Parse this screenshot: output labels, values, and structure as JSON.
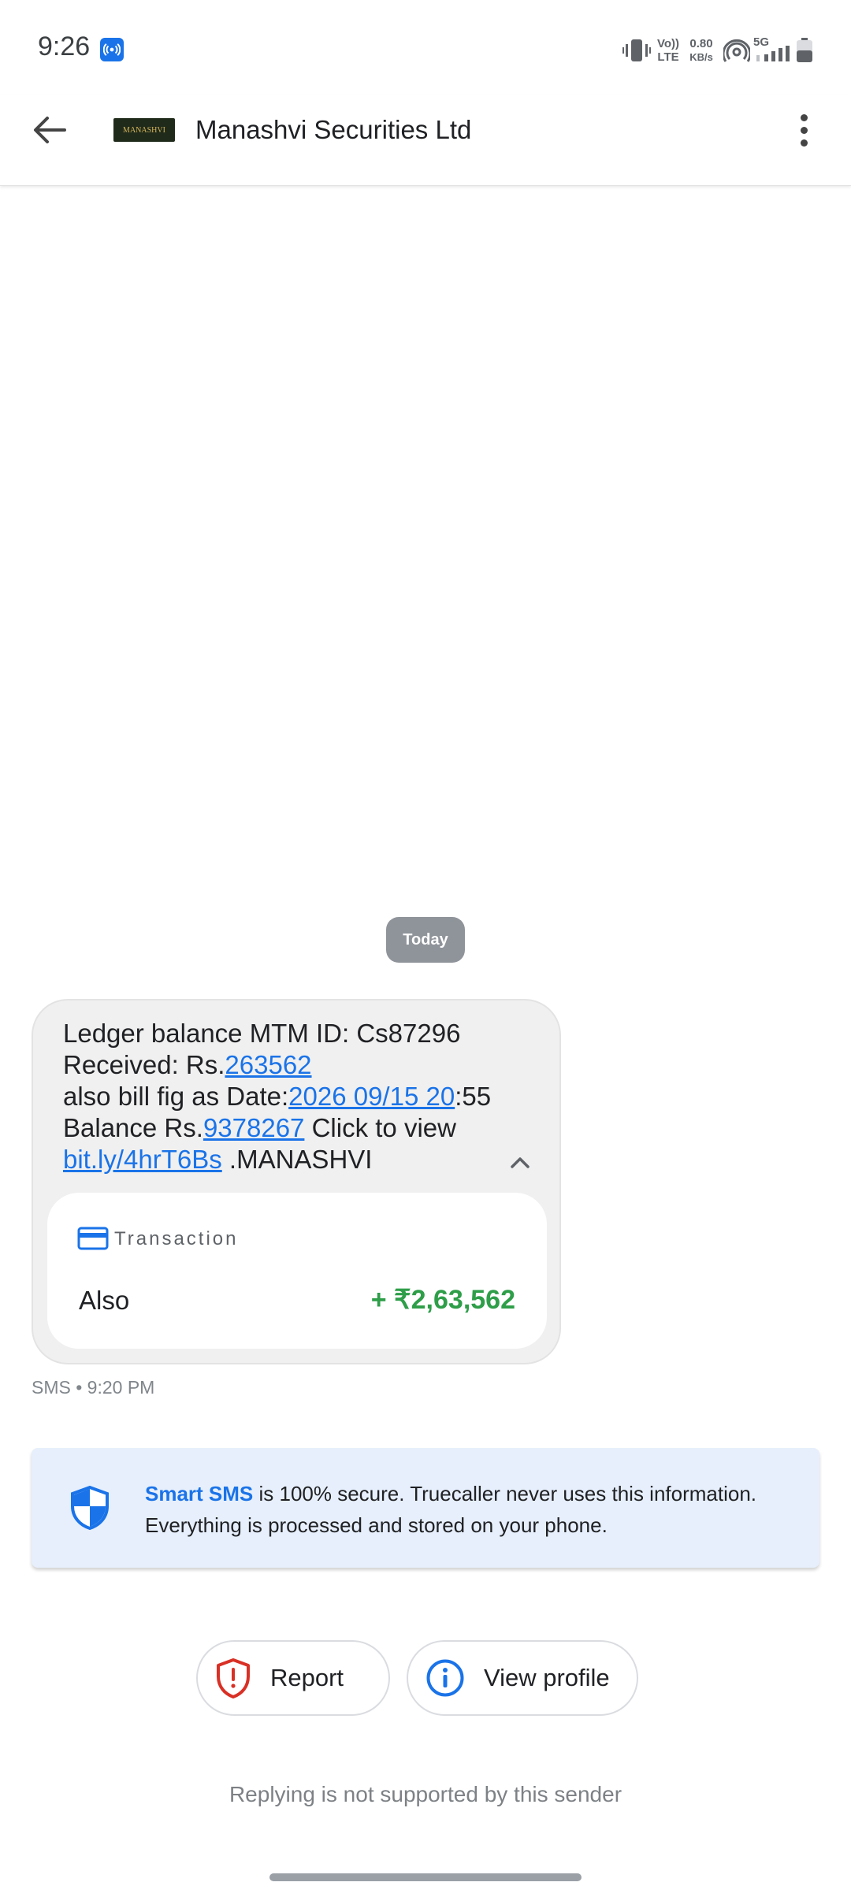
{
  "status_bar": {
    "time": "9:26",
    "volte_top": "Vo))",
    "volte_bottom": "LTE",
    "speed_value": "0.80",
    "speed_unit": "KB/s",
    "network": "5G",
    "icons": [
      "hotspot-icon",
      "vibrate-icon",
      "wifi-icon",
      "signal-icon",
      "battery-icon"
    ]
  },
  "header": {
    "logo_text": "MANASHVI",
    "title": "Manashvi Securities Ltd"
  },
  "date_separator": "Today",
  "message": {
    "line1": "Ledger balance MTM ID: Cs87296",
    "received_prefix": "Received: Rs.",
    "received_amount": "263562",
    "bill_prefix": "also bill fig as Date:",
    "bill_date_link": "2026 09/15 20",
    "bill_suffix": ":55",
    "balance_prefix": "Balance Rs.",
    "balance_amount": "9378267",
    "click_text": " Click to view",
    "url": "bit.ly/4hrT6Bs",
    "sender_tag": " .MANASHVI",
    "meta": "SMS • 9:20 PM"
  },
  "transaction_card": {
    "label": "Transaction",
    "description": "Also",
    "amount": "+ ₹2,63,562"
  },
  "info_banner": {
    "highlight": "Smart SMS",
    "text": " is 100% secure. Truecaller never uses this information. Everything is processed and stored on your phone."
  },
  "actions": {
    "report": "Report",
    "view_profile": "View profile"
  },
  "footer": "Replying is not supported by this sender",
  "colors": {
    "accent": "#1a73e8",
    "amount_green": "#2e9e49",
    "report_red": "#d93025",
    "banner_bg": "#e6effb"
  }
}
